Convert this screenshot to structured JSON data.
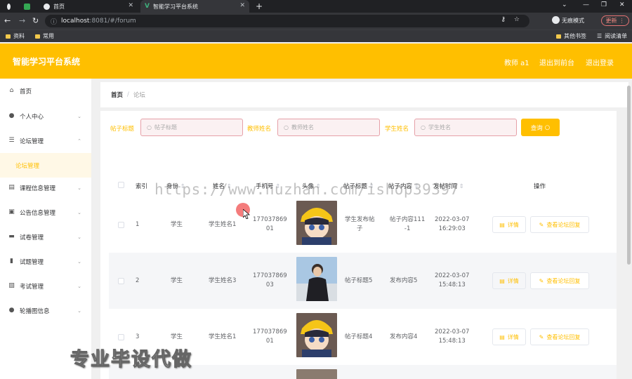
{
  "browser": {
    "tabs": [
      {
        "label": ""
      },
      {
        "label": "首页"
      },
      {
        "label": "智能学习平台系统"
      }
    ],
    "address": {
      "host": "localhost",
      "path": ":8081/#/forum"
    },
    "incognito_label": "无痕模式",
    "update_label": "更新",
    "bookmarks": {
      "left": [
        "资料",
        "常用"
      ],
      "right": [
        "其他书签",
        "阅读清单"
      ]
    }
  },
  "header": {
    "title": "智能学习平台系统",
    "user": "教师 a1",
    "back_front": "退出到前台",
    "logout": "退出登录"
  },
  "sidebar": {
    "items": [
      {
        "label": "首页",
        "icon": "home-icon"
      },
      {
        "label": "个人中心",
        "icon": "user-icon"
      },
      {
        "label": "论坛管理",
        "icon": "sliders-icon"
      },
      {
        "label": "论坛管理",
        "icon": ""
      },
      {
        "label": "课程信息管理",
        "icon": "list-icon"
      },
      {
        "label": "公告信息管理",
        "icon": "clipboard-icon"
      },
      {
        "label": "试卷管理",
        "icon": "doc-icon"
      },
      {
        "label": "试题管理",
        "icon": "bars-icon"
      },
      {
        "label": "考试管理",
        "icon": "exam-icon"
      },
      {
        "label": "轮播图信息",
        "icon": "user-icon"
      }
    ]
  },
  "breadcrumb": {
    "home": "首页",
    "sep": "/",
    "current": "论坛"
  },
  "filters": {
    "title_label": "帖子标题",
    "title_placeholder": "帖子标题",
    "teacher_label": "教师姓名",
    "teacher_placeholder": "教师姓名",
    "student_label": "学生姓名",
    "student_placeholder": "学生姓名",
    "search_button": "查询"
  },
  "table": {
    "columns": [
      "索引",
      "身份",
      "姓名",
      "手机号",
      "头像",
      "帖子标题",
      "帖子内容",
      "发帖时间",
      "操作"
    ],
    "rows": [
      {
        "index": "1",
        "role": "学生",
        "name": "学生姓名1",
        "phone1": "177037869",
        "phone2": "01",
        "title1": "学生发布帖",
        "title2": "子",
        "content1": "帖子内容111",
        "content2": "-1",
        "date": "2022-03-07",
        "time": "16:29:03",
        "avatar": "cartoon-avatar"
      },
      {
        "index": "2",
        "role": "学生",
        "name": "学生姓名3",
        "phone1": "177037869",
        "phone2": "03",
        "title1": "帖子标题5",
        "title2": "",
        "content1": "发布内容5",
        "content2": "",
        "date": "2022-03-07",
        "time": "15:48:13",
        "avatar": "photo-avatar"
      },
      {
        "index": "3",
        "role": "学生",
        "name": "学生姓名1",
        "phone1": "177037869",
        "phone2": "01",
        "title1": "帖子标题4",
        "title2": "",
        "content1": "发布内容4",
        "content2": "",
        "date": "2022-03-07",
        "time": "15:48:13",
        "avatar": "cartoon-avatar"
      }
    ],
    "detail_button": "详情",
    "reply_button": "查看论坛回复"
  },
  "watermarks": {
    "url": "https://www.huzhan.com/ishop39397",
    "cn": "专业毕设代做"
  },
  "colors": {
    "accent": "#ffbf00",
    "header": "#ffbf00"
  }
}
